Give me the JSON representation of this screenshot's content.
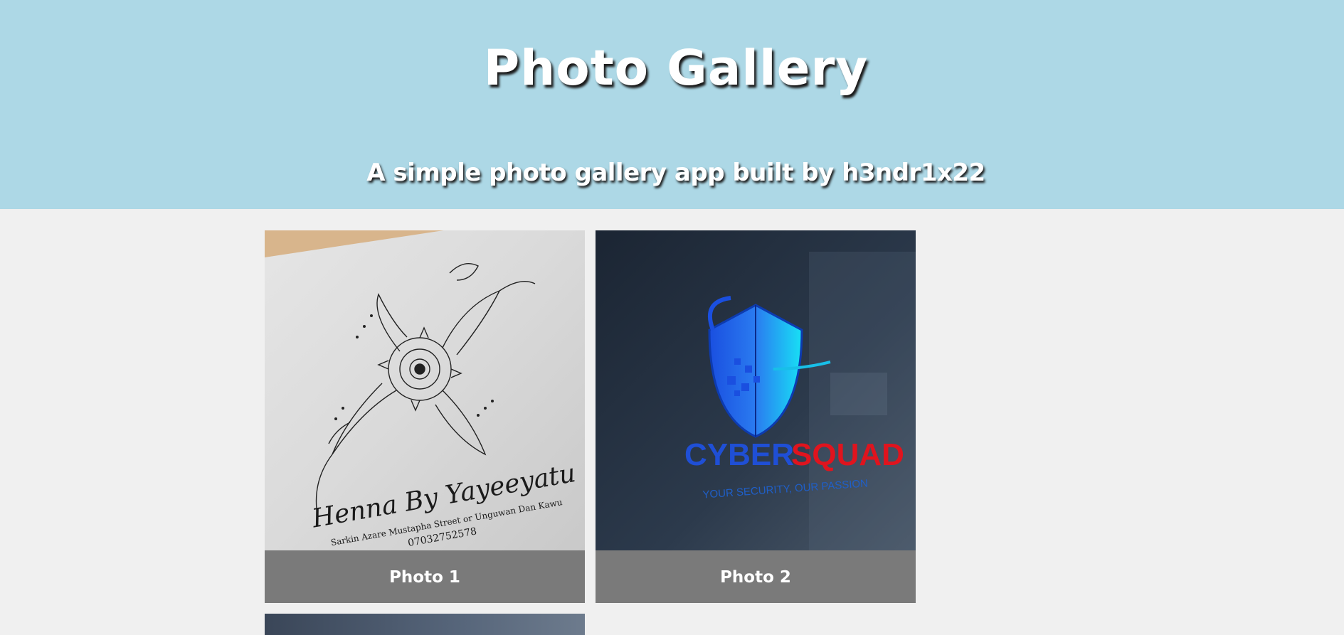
{
  "header": {
    "title": "Photo Gallery",
    "subtitle": "A simple photo gallery app built by h3ndr1x22",
    "background": "#add8e6"
  },
  "gallery": {
    "photos": [
      {
        "caption": "Photo 1",
        "image": {
          "line1": "Henna By Yayeeyatu",
          "line2": "Sarkin Azare Mustapha Street or Unguwan Dan Kawu",
          "line3": "07032752578"
        }
      },
      {
        "caption": "Photo 2",
        "image": {
          "brand_part1": "CYBER",
          "brand_part2": "SQUAD",
          "tagline": "YOUR SECURITY, OUR PASSION"
        }
      },
      {
        "caption": ""
      }
    ]
  },
  "colors": {
    "caption_bar": "#7a7a7a",
    "page_background": "#f0f0f0",
    "cyber_blue": "#1f4fd6",
    "cyber_red": "#e0141e"
  }
}
